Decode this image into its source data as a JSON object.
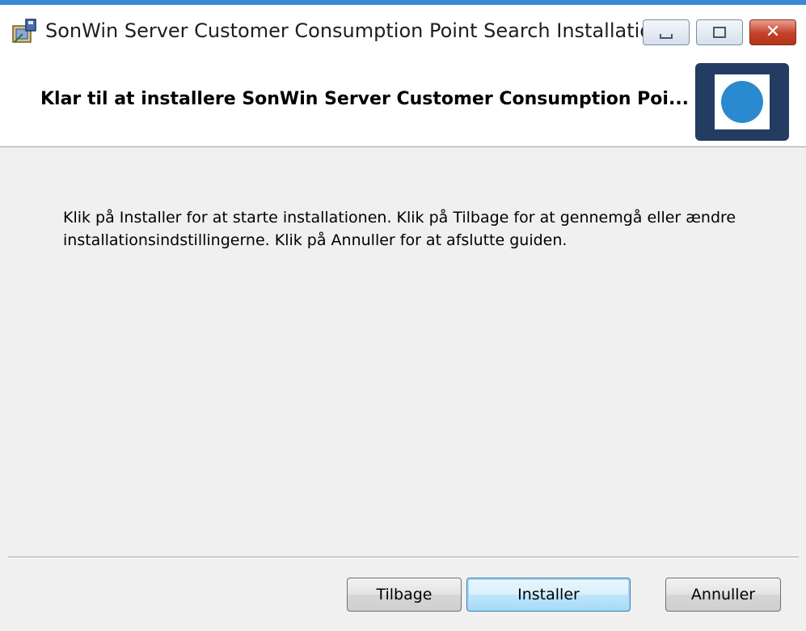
{
  "window": {
    "title": "SonWin Server Customer Consumption Point Search Installation"
  },
  "header": {
    "title": "Klar til at installere SonWin Server Customer Consumption Poi..."
  },
  "main": {
    "instructions": "Klik på Installer for at starte installationen. Klik på Tilbage for at gennemgå eller ændre installationsindstillingerne. Klik på Annuller for at afslutte guiden."
  },
  "buttons": {
    "back": "Tilbage",
    "install": "Installer",
    "cancel": "Annuller"
  },
  "colors": {
    "logo_background": "#243b62",
    "logo_dot": "#2a8ad0",
    "title_accent": "#3a8ad6"
  }
}
